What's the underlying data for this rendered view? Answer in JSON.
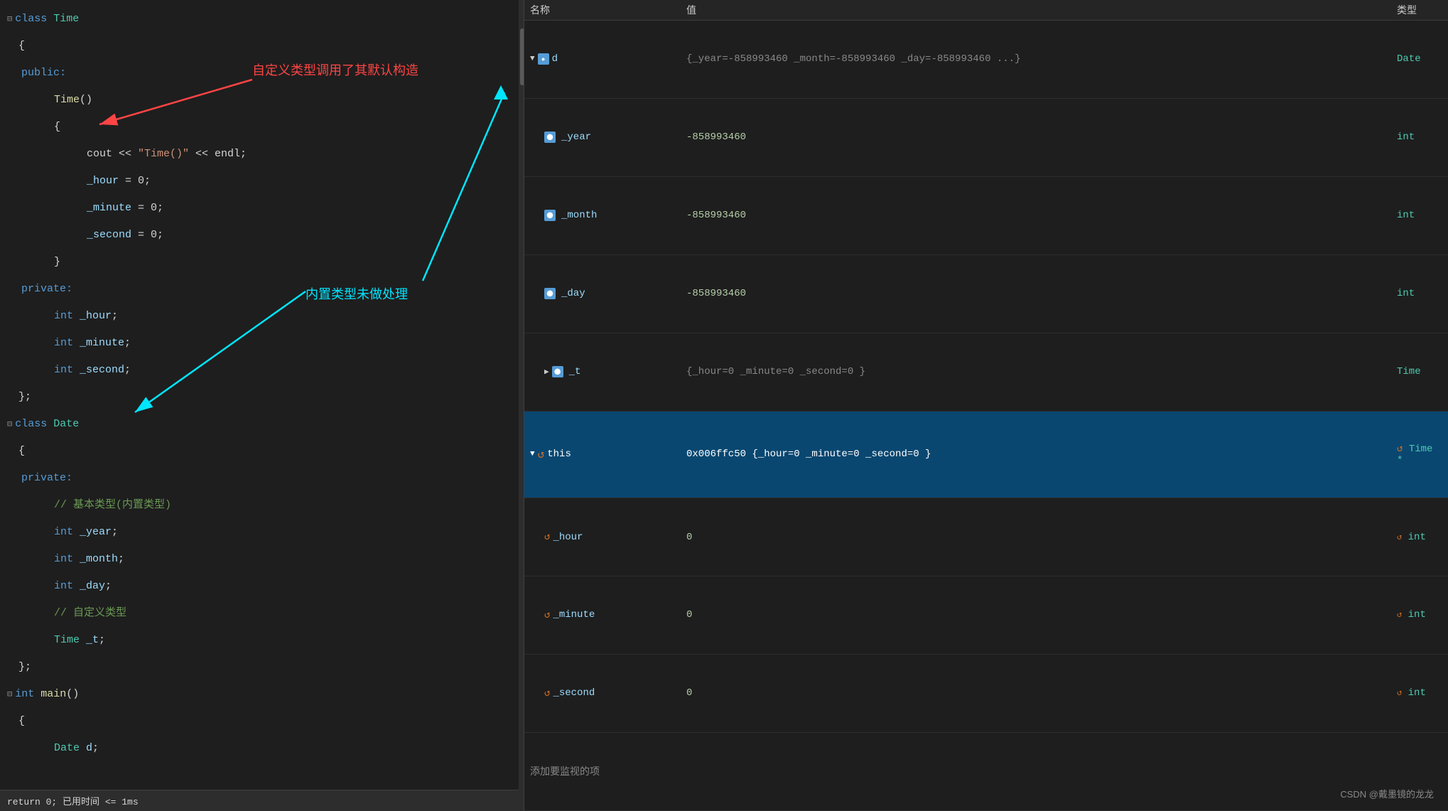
{
  "editor": {
    "lines": [
      {
        "id": 1,
        "indent": 0,
        "collapse": "⊟",
        "content": "class Time",
        "type": "class-def"
      },
      {
        "id": 2,
        "indent": 0,
        "content": "{",
        "type": "brace"
      },
      {
        "id": 3,
        "indent": 1,
        "content": "public:",
        "type": "access"
      },
      {
        "id": 4,
        "indent": 2,
        "content": "Time()",
        "type": "constructor"
      },
      {
        "id": 5,
        "indent": 2,
        "content": "{",
        "type": "brace"
      },
      {
        "id": 6,
        "indent": 3,
        "content": "cout << \"Time()\" << endl;",
        "type": "statement"
      },
      {
        "id": 7,
        "indent": 3,
        "content": "_hour = 0;",
        "type": "statement"
      },
      {
        "id": 8,
        "indent": 3,
        "content": "_minute = 0;",
        "type": "statement"
      },
      {
        "id": 9,
        "indent": 3,
        "content": "_second = 0;",
        "type": "statement"
      },
      {
        "id": 10,
        "indent": 2,
        "content": "}",
        "type": "brace"
      },
      {
        "id": 11,
        "indent": 1,
        "content": "private:",
        "type": "access"
      },
      {
        "id": 12,
        "indent": 2,
        "content": "int _hour;",
        "type": "decl"
      },
      {
        "id": 13,
        "indent": 2,
        "content": "int _minute;",
        "type": "decl"
      },
      {
        "id": 14,
        "indent": 2,
        "content": "int _second;",
        "type": "decl"
      },
      {
        "id": 15,
        "indent": 0,
        "content": "};",
        "type": "brace"
      },
      {
        "id": 16,
        "indent": 0,
        "collapse": "⊟",
        "content": "class Date",
        "type": "class-def"
      },
      {
        "id": 17,
        "indent": 0,
        "content": "{",
        "type": "brace"
      },
      {
        "id": 18,
        "indent": 1,
        "content": "private:",
        "type": "access"
      },
      {
        "id": 19,
        "indent": 2,
        "content": "// 基本类型(内置类型)",
        "type": "comment"
      },
      {
        "id": 20,
        "indent": 2,
        "content": "int _year;",
        "type": "decl"
      },
      {
        "id": 21,
        "indent": 2,
        "content": "int _month;",
        "type": "decl"
      },
      {
        "id": 22,
        "indent": 2,
        "content": "int _day;",
        "type": "decl"
      },
      {
        "id": 23,
        "indent": 2,
        "content": "// 自定义类型",
        "type": "comment"
      },
      {
        "id": 24,
        "indent": 2,
        "content": "Time _t;",
        "type": "decl"
      },
      {
        "id": 25,
        "indent": 0,
        "content": "};",
        "type": "brace"
      },
      {
        "id": 26,
        "indent": 0,
        "collapse": "⊟",
        "content": "int main()",
        "type": "func-def"
      },
      {
        "id": 27,
        "indent": 0,
        "content": "{",
        "type": "brace"
      },
      {
        "id": 28,
        "indent": 2,
        "content": "Date d;",
        "type": "statement"
      }
    ],
    "status": "return 0;  已用时间 <= 1ms"
  },
  "annotations": {
    "custom_type_label": "自定义类型调用了其默认构造",
    "builtin_type_label": "内置类型未做处理"
  },
  "debug": {
    "columns": {
      "name": "名称",
      "value": "值",
      "type": "类型"
    },
    "rows": [
      {
        "id": "d",
        "indent": 0,
        "expanded": true,
        "collapse_arrow": "▼",
        "icon_type": "blue",
        "name": "d",
        "value": "{_year=-858993460 _month=-858993460 _day=-858993460 ...}",
        "type": "Date",
        "selected": false
      },
      {
        "id": "_year",
        "indent": 1,
        "expanded": false,
        "icon_type": "blue",
        "name": "_year",
        "value": "-858993460",
        "type": "int",
        "selected": false
      },
      {
        "id": "_month",
        "indent": 1,
        "expanded": false,
        "icon_type": "blue",
        "name": "_month",
        "value": "-858993460",
        "type": "int",
        "selected": false
      },
      {
        "id": "_day",
        "indent": 1,
        "expanded": false,
        "icon_type": "blue",
        "name": "_day",
        "value": "-858993460",
        "type": "int",
        "selected": false
      },
      {
        "id": "_t",
        "indent": 1,
        "expanded": false,
        "collapse_arrow": "▶",
        "icon_type": "blue",
        "name": "_t",
        "value": "{_hour=0 _minute=0 _second=0 }",
        "type": "Time",
        "selected": false
      },
      {
        "id": "this",
        "indent": 0,
        "expanded": true,
        "collapse_arrow": "▼",
        "icon_type": "orange",
        "name": "this",
        "value": "0x006ffc50 {_hour=0 _minute=0 _second=0 }",
        "type": "Time *",
        "selected": true
      },
      {
        "id": "_hour",
        "indent": 1,
        "expanded": false,
        "icon_type": "orange",
        "name": "_hour",
        "value": "0",
        "type": "int",
        "selected": false
      },
      {
        "id": "_minute",
        "indent": 1,
        "expanded": false,
        "icon_type": "orange",
        "name": "_minute",
        "value": "0",
        "type": "int",
        "selected": false
      },
      {
        "id": "_second",
        "indent": 1,
        "expanded": false,
        "icon_type": "orange",
        "name": "_second",
        "value": "0",
        "type": "int",
        "selected": false
      }
    ],
    "add_watch_label": "添加要监视的项"
  },
  "watermark": "CSDN @戴墨镜的龙龙"
}
